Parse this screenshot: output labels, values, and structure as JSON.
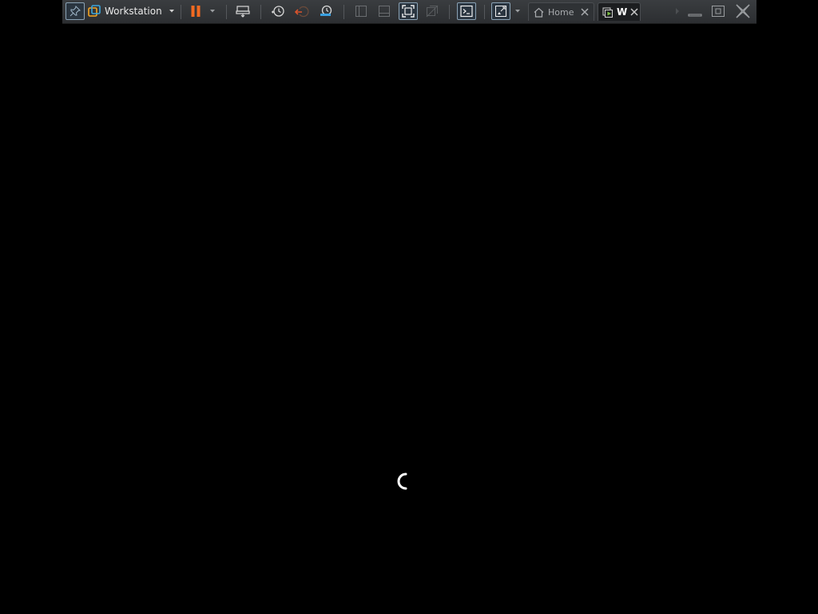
{
  "toolbar": {
    "product_label": "Workstation",
    "tabs": [
      {
        "label": "Home"
      },
      {
        "label": "W"
      }
    ]
  },
  "colors": {
    "pause": "#f26a21",
    "snapshot_revert": "#d9532c",
    "snapshot_manage": "#3aa0e0",
    "vm_tab_icon": "#7dc242"
  }
}
